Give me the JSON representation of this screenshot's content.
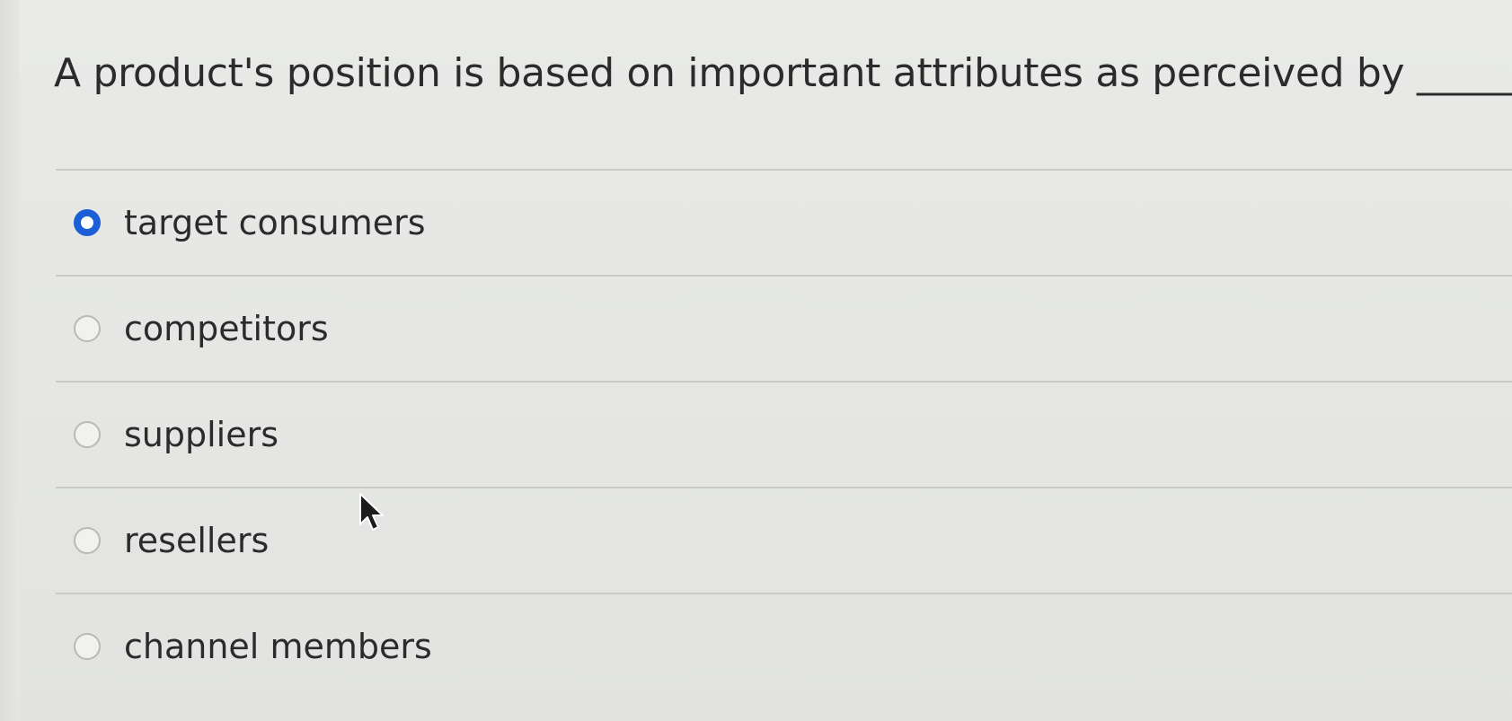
{
  "question": {
    "text": "A product's position is based on important attributes as perceived by ________"
  },
  "options": [
    {
      "label": "target consumers",
      "selected": true
    },
    {
      "label": "competitors",
      "selected": false
    },
    {
      "label": "suppliers",
      "selected": false
    },
    {
      "label": "resellers",
      "selected": false
    },
    {
      "label": "channel members",
      "selected": false
    }
  ],
  "colors": {
    "accent": "#1a5fd6",
    "background": "#e7e8e6",
    "divider": "#c9cbc9",
    "text": "#2b2b2b"
  },
  "icons": {
    "cursor": "mouse-pointer-arrow-icon",
    "selected_radio": "radio-checked-icon",
    "unselected_radio": "radio-unchecked-icon"
  }
}
